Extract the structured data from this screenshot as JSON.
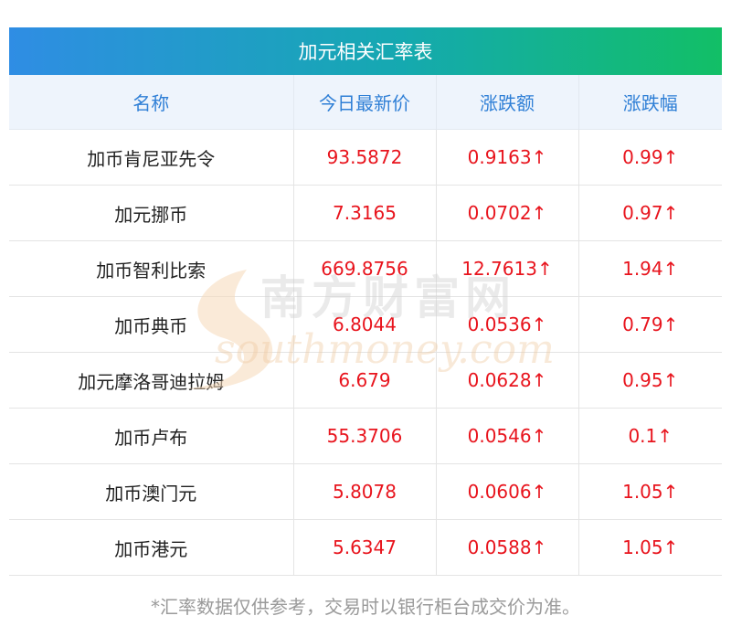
{
  "table": {
    "title": "加元相关汇率表",
    "headers": [
      "名称",
      "今日最新价",
      "涨跌额",
      "涨跌幅"
    ],
    "rows": [
      {
        "name": "加币肯尼亚先令",
        "price": "93.5872",
        "change": "0.9163↑",
        "pct": "0.99↑"
      },
      {
        "name": "加元挪币",
        "price": "7.3165",
        "change": "0.0702↑",
        "pct": "0.97↑"
      },
      {
        "name": "加币智利比索",
        "price": "669.8756",
        "change": "12.7613↑",
        "pct": "1.94↑"
      },
      {
        "name": "加币典币",
        "price": "6.8044",
        "change": "0.0536↑",
        "pct": "0.79↑"
      },
      {
        "name": "加元摩洛哥迪拉姆",
        "price": "6.679",
        "change": "0.0628↑",
        "pct": "0.95↑"
      },
      {
        "name": "加币卢布",
        "price": "55.3706",
        "change": "0.0546↑",
        "pct": "0.1↑"
      },
      {
        "name": "加币澳门元",
        "price": "5.8078",
        "change": "0.0606↑",
        "pct": "1.05↑"
      },
      {
        "name": "加币港元",
        "price": "5.6347",
        "change": "0.0588↑",
        "pct": "1.05↑"
      }
    ]
  },
  "watermark": {
    "text_cn": "南方财富网",
    "text_en": "southmoney.com"
  },
  "footnote": "*汇率数据仅供参考，交易时以银行柜台成交价为准。",
  "colors": {
    "header_text": "#2f7fd6",
    "up_value": "#e8141d",
    "title_gradient_start": "#2f8de4",
    "title_gradient_end": "#12bf66"
  }
}
